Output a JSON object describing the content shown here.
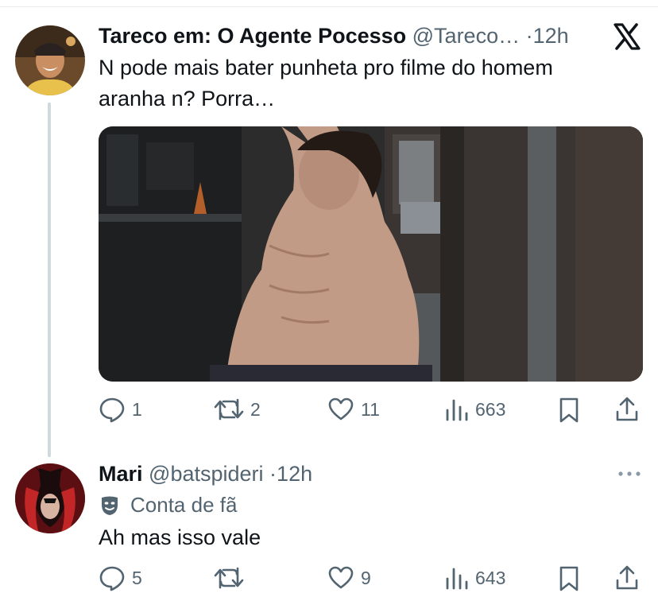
{
  "tweet": {
    "author_name": "Tareco em: O Agente Pocesso",
    "handle": "@Tareco…",
    "separator": "·",
    "time": "12h",
    "text": "N pode mais bater punheta pro filme do homem aranha n? Porra…",
    "media_icon": "photo",
    "platform_icon": "x-logo-icon",
    "actions": {
      "replies": "1",
      "retweets": "2",
      "likes": "11",
      "views": "663"
    }
  },
  "reply": {
    "author_name": "Mari",
    "handle": "@batspideri",
    "separator": "·",
    "time": "12h",
    "badge_label": "Conta de fã",
    "text": "Ah mas isso vale",
    "actions": {
      "replies": "5",
      "retweets": "",
      "likes": "9",
      "views": "643"
    }
  },
  "colors": {
    "text": "#0f1419",
    "secondary": "#536471",
    "thread_line": "#cfd9de"
  }
}
